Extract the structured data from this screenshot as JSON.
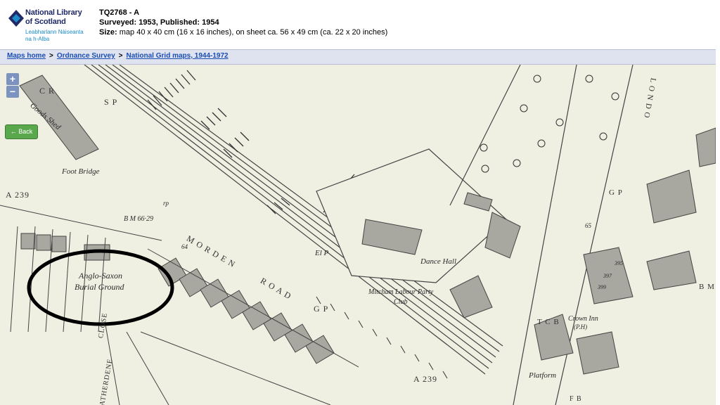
{
  "logo": {
    "line1": "National Library",
    "line2": "of Scotland",
    "line3": "Leabharlann Nàiseanta",
    "line4": "na h-Alba",
    "colors": {
      "navy": "#1f2a66",
      "blue": "#1c8bc8"
    }
  },
  "sheet": {
    "id": "TQ2768 - A",
    "dates": "Surveyed: 1953, Published: 1954",
    "size_label": "Size:",
    "size_value": "map 40 x 40 cm (16 x 16 inches), on sheet ca. 56 x 49 cm (ca. 22 x 20 inches)"
  },
  "breadcrumb": {
    "items": [
      "Maps home",
      "Ordnance Survey",
      "National Grid maps, 1944-1972"
    ],
    "separator": ">"
  },
  "map_controls": {
    "zoom_in": "+",
    "zoom_out": "−",
    "back": "← Back"
  },
  "map_labels": {
    "goods_shed": "Goods Shed",
    "foot_bridge": "Foot Bridge",
    "cr": "C R",
    "sp": "S P",
    "a239_left": "A 239",
    "a239_bottom": "A 239",
    "bm": "B M 66·29",
    "morden_road_1": "M O R D E N",
    "morden_road_2": "R O A D",
    "el_p": "El P",
    "gp_road": "G P",
    "dance_hall": "Dance Hall",
    "labour_club_1": "Mitcham Labour Party",
    "labour_club_2": "Club",
    "anglo_1": "Anglo-Saxon",
    "anglo_2": "Burial Ground",
    "close": "CLOSE",
    "atherdene": "ATHERDENE",
    "london_rd": "L O N D O",
    "tcb": "T C B",
    "crown_inn_1": "Crown Inn",
    "crown_inn_2": "(P.H)",
    "platform": "Platform",
    "gp_right": "G P",
    "bm_right": "B M",
    "fb": "F B",
    "rp": "rp",
    "num_64": "64",
    "num_65": "65",
    "num_395": "395",
    "num_397": "397",
    "num_399": "399"
  }
}
